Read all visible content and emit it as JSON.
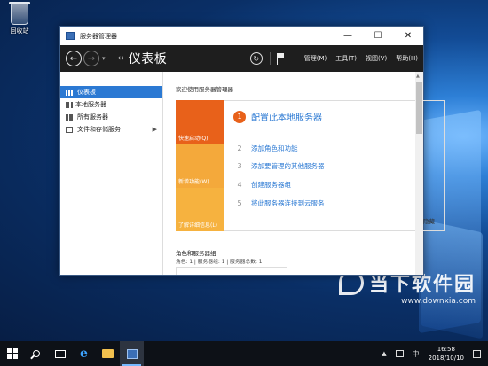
{
  "desktop": {
    "recycle_bin_label": "回收站"
  },
  "window": {
    "title": "服务器管理器",
    "controls": {
      "minimize": "—",
      "maximize": "☐",
      "close": "✕"
    }
  },
  "toolbar": {
    "breadcrumb_arrows": "‹‹",
    "page_title": "仪表板",
    "menus": [
      "管理(M)",
      "工具(T)",
      "视图(V)",
      "帮助(H)"
    ]
  },
  "sidebar": {
    "items": [
      {
        "label": "仪表板",
        "icon": "dashboard-icon",
        "active": true
      },
      {
        "label": "本地服务器",
        "icon": "server-icon",
        "active": false
      },
      {
        "label": "所有服务器",
        "icon": "servers-icon",
        "active": false
      },
      {
        "label": "文件和存储服务",
        "icon": "storage-icon",
        "active": false,
        "has_submenu": true
      }
    ]
  },
  "main": {
    "welcome": "欢迎使用服务器管理器",
    "tiles": [
      "快速启动(Q)",
      "新增功能(W)",
      "了解详细信息(L)"
    ],
    "step1": {
      "num": "1",
      "label": "配置此本地服务器"
    },
    "steps": [
      {
        "num": "2",
        "label": "添加角色和功能"
      },
      {
        "num": "3",
        "label": "添加要管理的其他服务器"
      },
      {
        "num": "4",
        "label": "创建服务器组"
      },
      {
        "num": "5",
        "label": "将此服务器连接到云服务"
      }
    ],
    "hide": "隐藏",
    "roles_title": "角色和服务器组",
    "roles_summary": "角色: 1 | 服务器组: 1 | 服务器总数: 1"
  },
  "taskbar": {
    "tray_text": "中",
    "time": "16:58",
    "date": "2018/10/10"
  },
  "watermark": {
    "brand": "当下软件园",
    "url": "www.downxia.com"
  },
  "colors": {
    "accent": "#2b79d3",
    "tile_orange": "#e8611a",
    "tile_amber": "#f4a93b",
    "toolbar_bg": "#1e1e1e"
  }
}
